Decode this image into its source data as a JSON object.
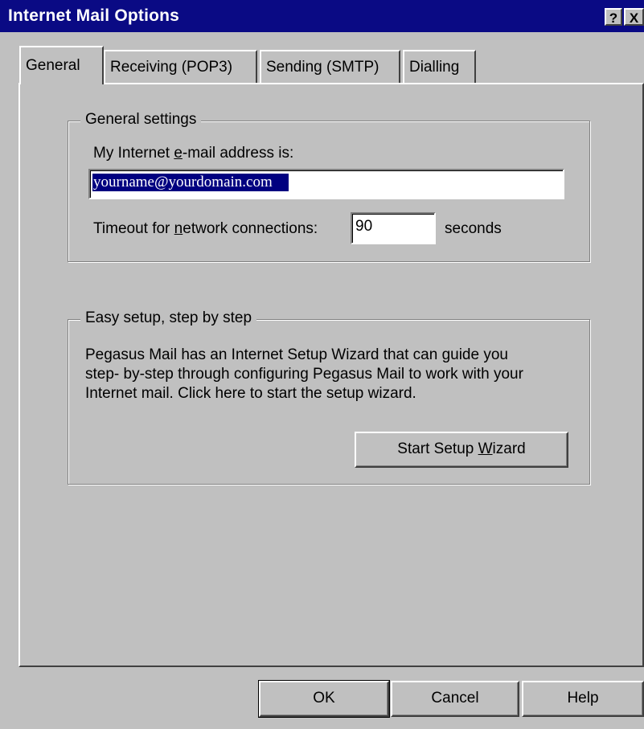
{
  "window": {
    "title": "Internet Mail Options",
    "help_glyph": "?",
    "close_glyph": "X"
  },
  "tabs": [
    {
      "label": "General",
      "active": true
    },
    {
      "label": "Receiving (POP3)",
      "active": false
    },
    {
      "label": "Sending (SMTP)",
      "active": false
    },
    {
      "label": "Dialling",
      "active": false
    }
  ],
  "general_settings": {
    "legend": "General settings",
    "email_label_pre": "My Internet ",
    "email_label_mnemonic": "e",
    "email_label_post": "-mail address is:",
    "email_value": "yourname@yourdomain.com",
    "timeout_label_pre": "Timeout for ",
    "timeout_label_mnemonic": "n",
    "timeout_label_post": "etwork connections:",
    "timeout_value": "90",
    "timeout_unit": "seconds"
  },
  "easy_setup": {
    "legend": "Easy setup, step by step",
    "line1": "Pegasus Mail has an Internet Setup Wizard that can guide you",
    "line2": "step- by-step through configuring Pegasus Mail to work with your",
    "line3": "Internet mail. Click here to start the setup wizard.",
    "wizard_button_pre": "Start Setup ",
    "wizard_button_mnemonic": "W",
    "wizard_button_post": "izard"
  },
  "footer": {
    "ok_label": "OK",
    "cancel_label": "Cancel",
    "help_label": "Help"
  },
  "colors": {
    "titlebar": "#0a0a84",
    "face": "#c0c0c0",
    "selection": "#000080"
  }
}
